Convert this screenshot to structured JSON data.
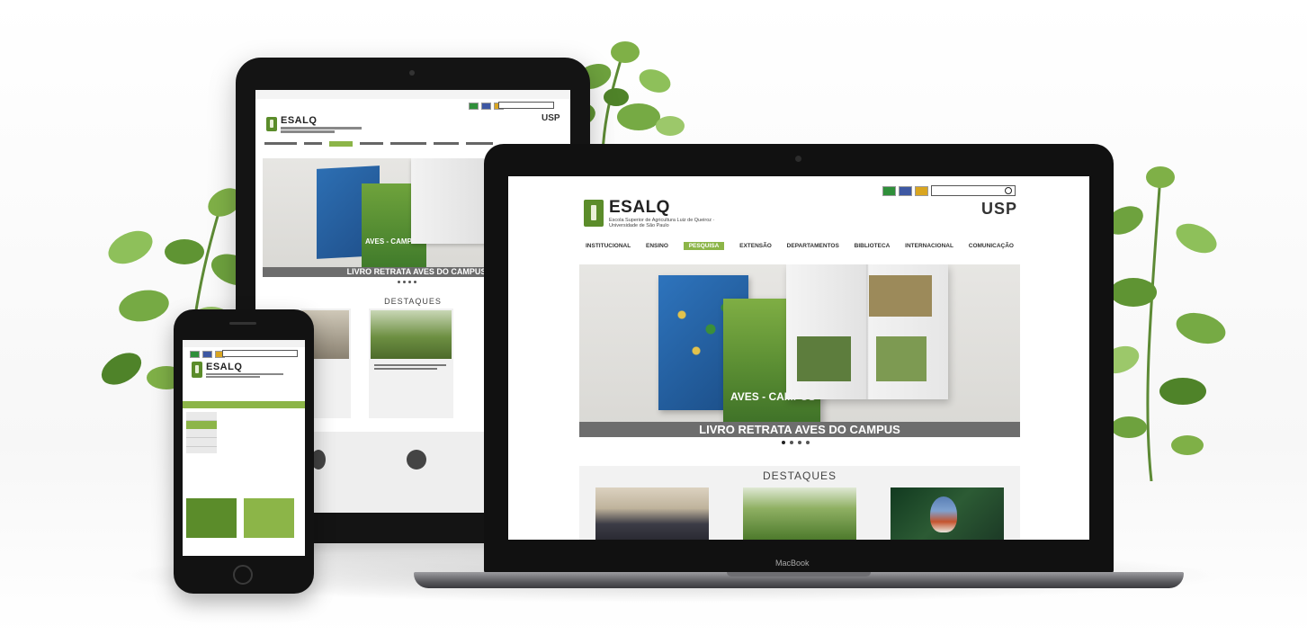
{
  "macbook": {
    "brand_label": "MacBook",
    "logo_title": "ESALQ",
    "logo_sub": "Escola Superior de Agricultura Luiz de Queiroz · Universidade de São Paulo",
    "usp_label": "USP",
    "nav": [
      "INSTITUCIONAL",
      "ENSINO",
      "PESQUISA",
      "EXTENSÃO",
      "DEPARTAMENTOS",
      "BIBLIOTECA",
      "INTERNACIONAL",
      "COMUNICAÇÃO"
    ],
    "active_nav_index": 2,
    "hero_caption": "LIVRO RETRATA AVES DO CAMPUS",
    "book_cover_title": "AVES - CAMPUS",
    "section_title": "DESTAQUES"
  },
  "tablet": {
    "logo_title": "ESALQ",
    "usp_label": "USP",
    "hero_caption": "LIVRO RETRATA AVES DO CAMPUS",
    "book_cover_title": "AVES - CAMPUS",
    "section_title": "DESTAQUES"
  },
  "phone": {
    "logo_title": "ESALQ"
  },
  "colors": {
    "brand_green": "#5b8c2a",
    "accent_green": "#8cb548",
    "caption_gray": "#6d6d6d",
    "device_black": "#161616"
  }
}
